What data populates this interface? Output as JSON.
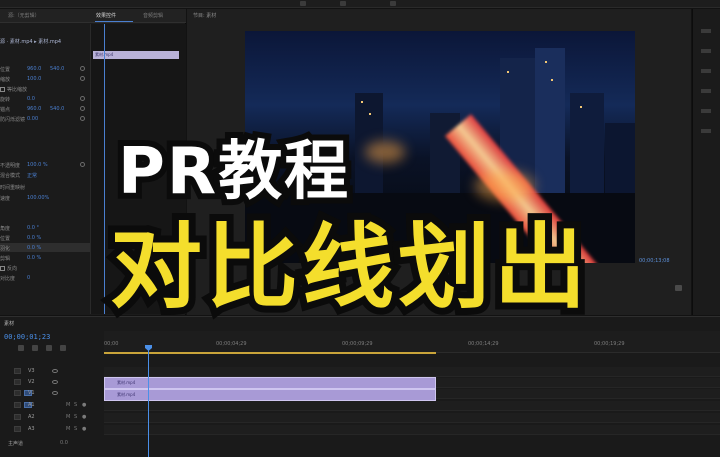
{
  "effect_panel": {
    "tabs": [
      {
        "label": "源:（无剪辑）"
      },
      {
        "label": "效果控件"
      },
      {
        "label": "音频剪辑"
      }
    ],
    "clip_line": "源 · 素材.mp4 ▸ 素材.mp4",
    "mini_clip_label": "素材.mp4",
    "rows": [
      {
        "label": "位置",
        "v1": "960.0",
        "v2": "540.0"
      },
      {
        "label": "缩放",
        "v1": "100.0",
        "v2": ""
      },
      {
        "label": "等比缩放",
        "v1": "",
        "v2": ""
      },
      {
        "label": "旋转",
        "v1": "0.0",
        "v2": ""
      },
      {
        "label": "锚点",
        "v1": "960.0",
        "v2": "540.0"
      },
      {
        "label": "防闪烁滤镜",
        "v1": "0.00",
        "v2": ""
      },
      {
        "label": "不透明度",
        "v1": "100.0 %",
        "v2": ""
      },
      {
        "label": "混合模式",
        "v1": "正常",
        "v2": ""
      },
      {
        "label": "时间重映射",
        "v1": "",
        "v2": ""
      },
      {
        "label": "速度",
        "v1": "100.00%",
        "v2": ""
      },
      {
        "label": "角度",
        "v1": "0.0 °",
        "v2": ""
      },
      {
        "label": "位置",
        "v1": "0.0 %",
        "v2": ""
      },
      {
        "label": "羽化",
        "v1": "0.0 %",
        "v2": ""
      },
      {
        "label": "剪辑",
        "v1": "0.0 %",
        "v2": ""
      },
      {
        "label": "反向",
        "v1": "",
        "v2": ""
      },
      {
        "label": "对比度",
        "v1": "0",
        "v2": ""
      }
    ]
  },
  "monitor": {
    "title": "节目: 素材",
    "timecode_right": "00;00;13;08"
  },
  "timeline": {
    "sequence_name": "素材",
    "current_time": "00;00;01;23",
    "ruler_ticks": [
      "00;00",
      "00;00;04;29",
      "00;00;09;29",
      "00;00;14;29",
      "00;00;19;29"
    ],
    "tracks": [
      {
        "name": "V3"
      },
      {
        "name": "V2"
      },
      {
        "name": "V1"
      },
      {
        "name": "A1"
      },
      {
        "name": "A2"
      },
      {
        "name": "A3"
      },
      {
        "name": "主声道",
        "level": "0.0"
      }
    ],
    "video_clip_label": "素材.mp4",
    "audio_clip_label": "素材.mp4"
  },
  "overlay": {
    "line1": "PR教程",
    "line2": "对比线划出"
  },
  "colors": {
    "accent_blue": "#4a8fe8",
    "clip_purple": "#a89ad6",
    "title_yellow": "#f4de2c",
    "workarea_gold": "#c9a43a"
  }
}
